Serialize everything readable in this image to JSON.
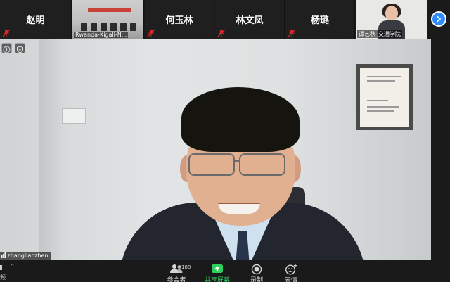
{
  "gallery": {
    "participants": [
      {
        "name": "赵明",
        "muted": true
      },
      {
        "name": "Rwanda-Kigali-N...",
        "muted": false,
        "video": true
      },
      {
        "name": "何玉林",
        "muted": true
      },
      {
        "name": "林文凤",
        "muted": true
      },
      {
        "name": "杨璐",
        "muted": true
      },
      {
        "name": "谭艺秋_交通学院",
        "muted": false,
        "video": true
      }
    ]
  },
  "speaker": {
    "name": "zhanglianzhen"
  },
  "toolbar": {
    "left_label": "频",
    "left_caret": "^",
    "participants_label": "参会者",
    "participants_count": "188",
    "share_label": "共享屏幕",
    "record_label": "录制",
    "reactions_label": "表情"
  },
  "colors": {
    "accent": "#2d8cff",
    "share_green": "#2ecf5d",
    "mute_red": "#e02828",
    "background": "#1a1a1a"
  },
  "icons": {
    "next_page": "chevron-right-icon",
    "info": "info-icon",
    "security": "shield-icon",
    "mute": "mic-muted-icon"
  }
}
